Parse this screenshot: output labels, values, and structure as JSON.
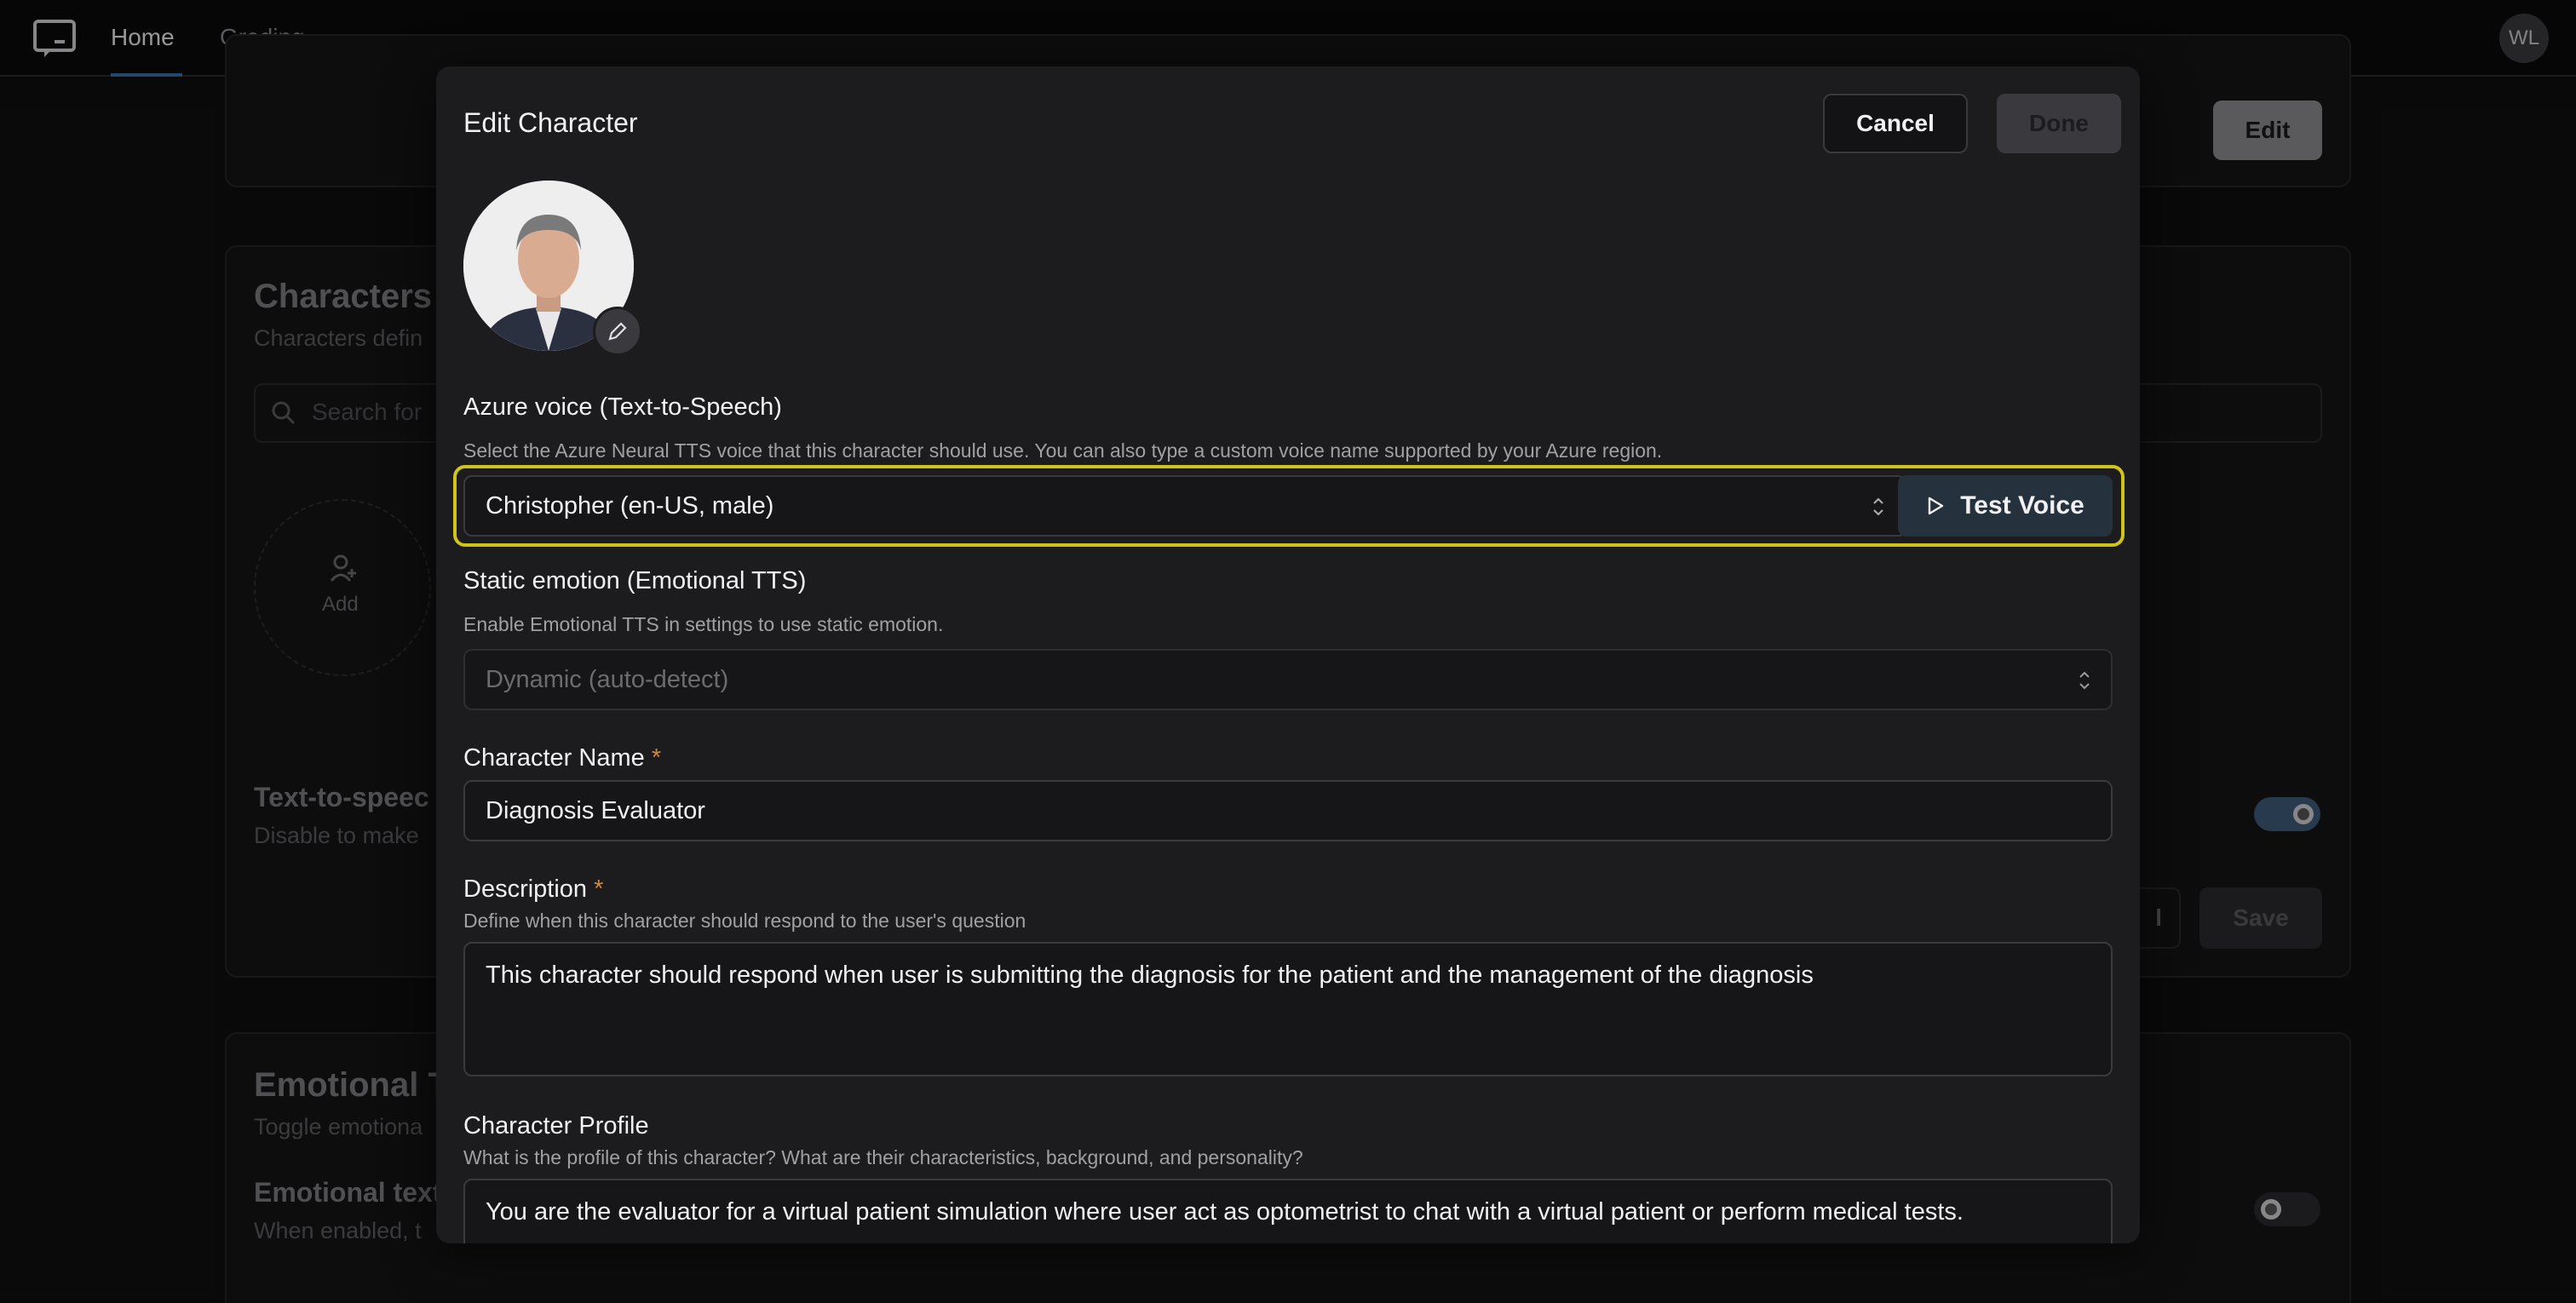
{
  "nav": {
    "tabs": [
      {
        "label": "Home",
        "active": true
      },
      {
        "label": "Grading",
        "active": false
      }
    ],
    "user_initials": "WL",
    "logo_icon": "chat-bubble-icon"
  },
  "background": {
    "characters_title": "Characters",
    "characters_sub": "Characters defin",
    "search_placeholder": "Search for",
    "add_label": "Add",
    "tts_title": "Text-to-speec",
    "tts_sub": "Disable to make",
    "edit_button": "Edit",
    "save_button": "Save",
    "cancel_partial": "l",
    "emotional_title": "Emotional T",
    "emotional_sub": "Toggle emotiona",
    "emotional_text_title": "Emotional text",
    "emotional_text_sub": "When enabled, t"
  },
  "modal": {
    "title": "Edit Character",
    "cancel_label": "Cancel",
    "done_label": "Done",
    "voice": {
      "label": "Azure voice (Text-to-Speech)",
      "help": "Select the Azure Neural TTS voice that this character should use. You can also type a custom voice name supported by your Azure region.",
      "value": "Christopher (en-US, male)",
      "test_label": "Test Voice",
      "highlight_color": "#cfc51a"
    },
    "emotion": {
      "label": "Static emotion (Emotional TTS)",
      "help": "Enable Emotional TTS in settings to use static emotion.",
      "value": "Dynamic (auto-detect)"
    },
    "name": {
      "label": "Character Name",
      "required": "*",
      "value": "Diagnosis Evaluator"
    },
    "description": {
      "label": "Description",
      "required": "*",
      "help": "Define when this character should respond to the user's question",
      "value": "This character should respond when user is submitting the diagnosis for the patient and the management of the diagnosis"
    },
    "profile": {
      "label": "Character Profile",
      "help": "What is the profile of this character? What are their characteristics, background, and personality?",
      "value": "You are the evaluator for a virtual patient simulation where user act as optometrist to chat with a virtual patient or perform medical tests."
    }
  }
}
